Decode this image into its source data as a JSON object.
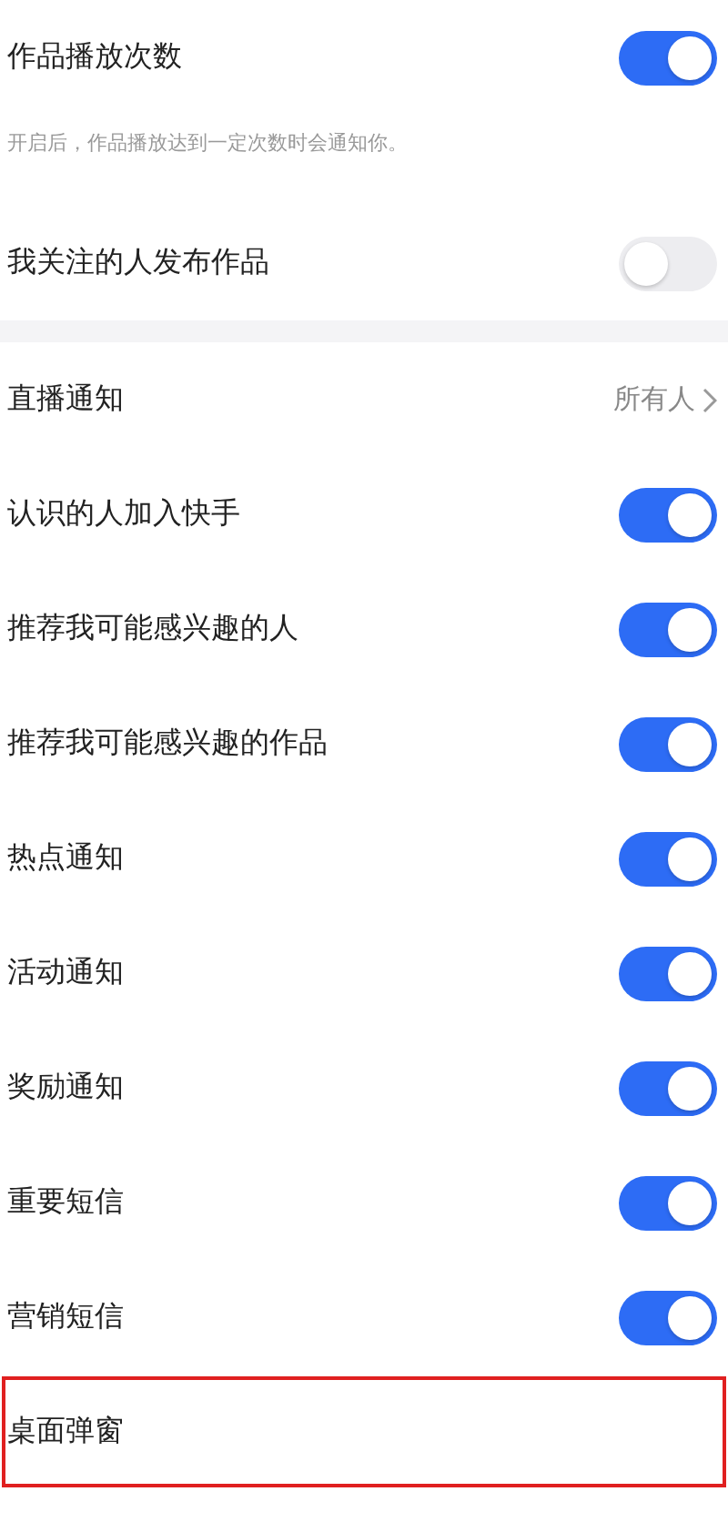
{
  "sections": [
    {
      "items": [
        {
          "kind": "toggle",
          "label": "作品播放次数",
          "on": true,
          "highlighted": false
        },
        {
          "kind": "note",
          "label": "开启后，作品播放达到一定次数时会通知你。"
        },
        {
          "kind": "toggle",
          "label": "我关注的人发布作品",
          "on": false,
          "highlighted": false
        }
      ]
    },
    {
      "items": [
        {
          "kind": "link",
          "label": "直播通知",
          "value": "所有人",
          "highlighted": false
        },
        {
          "kind": "toggle",
          "label": "认识的人加入快手",
          "on": true,
          "highlighted": false
        },
        {
          "kind": "toggle",
          "label": "推荐我可能感兴趣的人",
          "on": true,
          "highlighted": false
        },
        {
          "kind": "toggle",
          "label": "推荐我可能感兴趣的作品",
          "on": true,
          "highlighted": false
        },
        {
          "kind": "toggle",
          "label": "热点通知",
          "on": true,
          "highlighted": false
        },
        {
          "kind": "toggle",
          "label": "活动通知",
          "on": true,
          "highlighted": false
        },
        {
          "kind": "toggle",
          "label": "奖励通知",
          "on": true,
          "highlighted": false
        },
        {
          "kind": "toggle",
          "label": "重要短信",
          "on": true,
          "highlighted": false
        },
        {
          "kind": "toggle",
          "label": "营销短信",
          "on": true,
          "highlighted": false
        },
        {
          "kind": "plain",
          "label": "桌面弹窗",
          "highlighted": true
        }
      ]
    }
  ]
}
